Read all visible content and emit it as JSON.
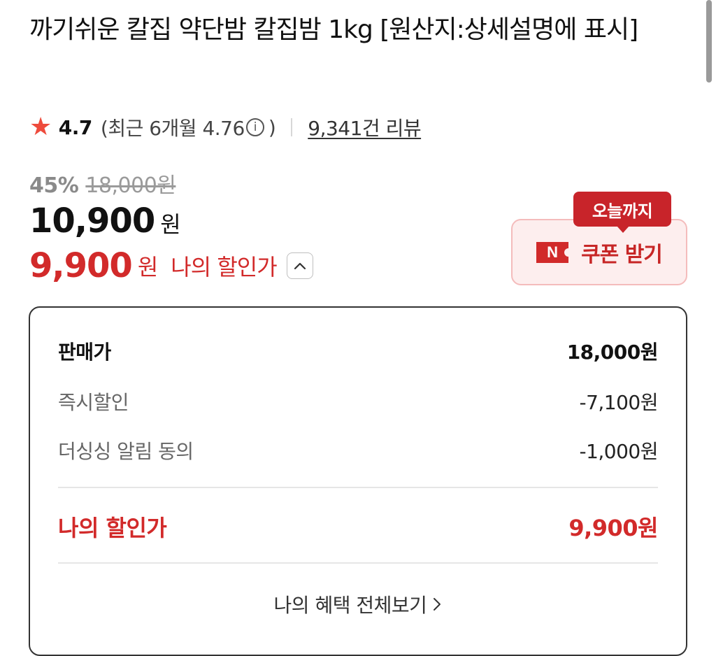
{
  "product": {
    "title": "까기쉬운 칼집 약단밤 칼집밤 1kg [원산지:상세설명에 표시]"
  },
  "rating": {
    "star_icon": "star-icon",
    "value": "4.7",
    "recent_prefix": "(최근 6개월 4.76",
    "recent_suffix": ")",
    "review_link": "9,341건 리뷰"
  },
  "price": {
    "discount_percent": "45%",
    "original": "18,000원",
    "sale": "10,900",
    "sale_unit": "원",
    "my_price": "9,900",
    "my_unit": "원",
    "my_label": "나의 할인가"
  },
  "coupon": {
    "badge": "오늘까지",
    "ticket_letter": "N",
    "label": "쿠폰 받기"
  },
  "breakdown": {
    "sell_label": "판매가",
    "sell_value": "18,000원",
    "instant_label": "즉시할인",
    "instant_value": "-7,100원",
    "agree_label": "더싱싱 알림 동의",
    "agree_value": "-1,000원",
    "final_label": "나의 할인가",
    "final_value": "9,900원",
    "view_all": "나의 혜택 전체보기"
  },
  "colors": {
    "accent_red": "#d22a2a",
    "star": "#ee4b3c",
    "coupon_bg": "#fdeeee"
  }
}
